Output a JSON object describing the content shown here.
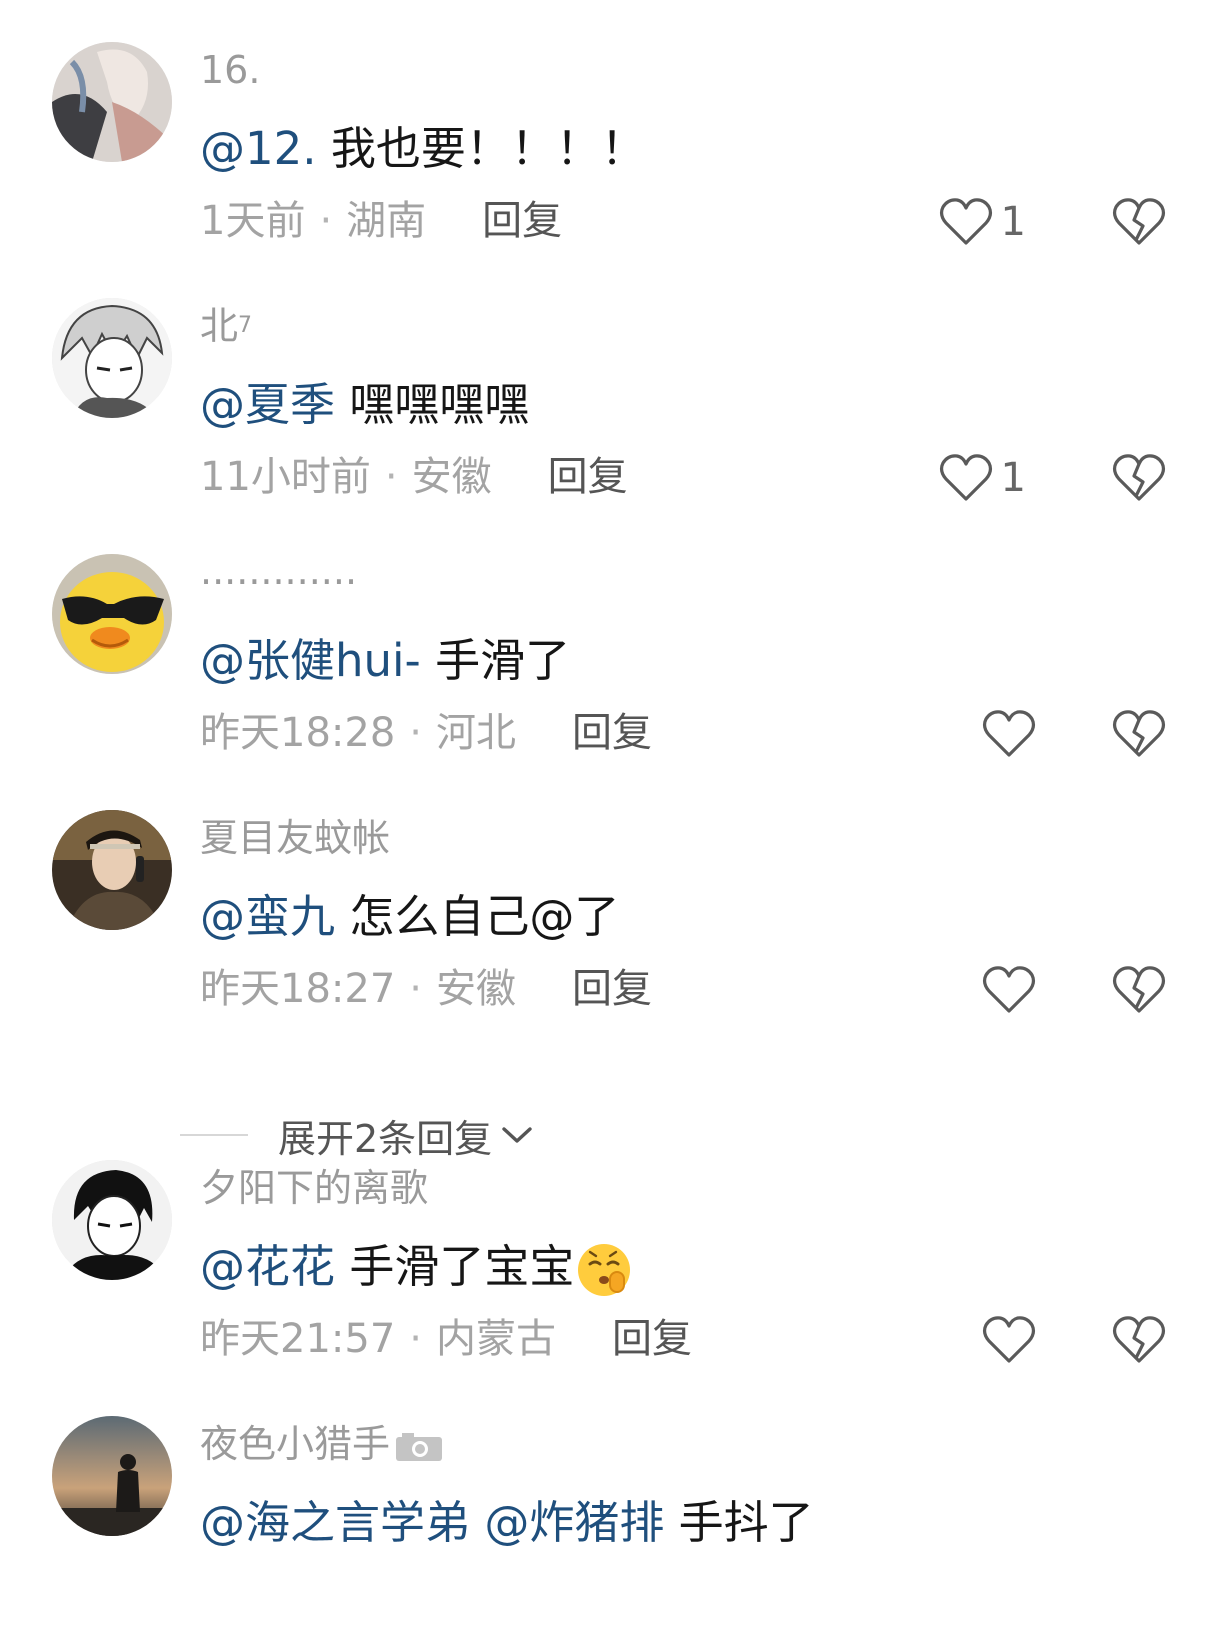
{
  "comments": [
    {
      "username": "16.",
      "mentions": [
        "@12."
      ],
      "text": "我也要！！！！",
      "time": "1天前",
      "location": "湖南",
      "reply_label": "回复",
      "like_count": "1",
      "avatar": "illustrated-figure-avatar"
    },
    {
      "username": "北",
      "username_sup": "7",
      "mentions": [
        "@夏季"
      ],
      "text": "嘿嘿嘿嘿",
      "time": "11小时前",
      "location": "安徽",
      "reply_label": "回复",
      "like_count": "1",
      "avatar": "manga-boy-avatar"
    },
    {
      "username": "·············",
      "mentions": [
        "@张健hui-"
      ],
      "text": "手滑了",
      "time": "昨天18:28",
      "location": "河北",
      "reply_label": "回复",
      "like_count": "",
      "avatar": "yellow-duck-sunglasses-avatar"
    },
    {
      "username": "夏目友蚊帐",
      "mentions": [
        "@蛮九"
      ],
      "text": "怎么自己@了",
      "time": "昨天18:27",
      "location": "安徽",
      "reply_label": "回复",
      "like_count": "",
      "avatar": "costume-portrait-avatar"
    },
    {
      "username": "夕阳下的离歌",
      "mentions": [
        "@花花"
      ],
      "text": "手滑了宝宝",
      "time": "昨天21:57",
      "location": "内蒙古",
      "reply_label": "回复",
      "like_count": "",
      "avatar": "anime-boy-avatar",
      "emoji": "shushing-face-emoji"
    },
    {
      "username": "夜色小猎手",
      "mentions": [
        "@海之言学弟",
        "@炸猪排"
      ],
      "text": "手抖了",
      "avatar": "sunset-silhouette-avatar",
      "badge_icon": "camera-icon"
    }
  ],
  "expand_replies": {
    "label": "展开2条回复",
    "icon": "chevron-down-icon"
  },
  "colors": {
    "mention": "#1f4f7d",
    "username": "#9a9a9a",
    "meta": "#a3a3a3",
    "icon_stroke": "#5a5a5a"
  }
}
